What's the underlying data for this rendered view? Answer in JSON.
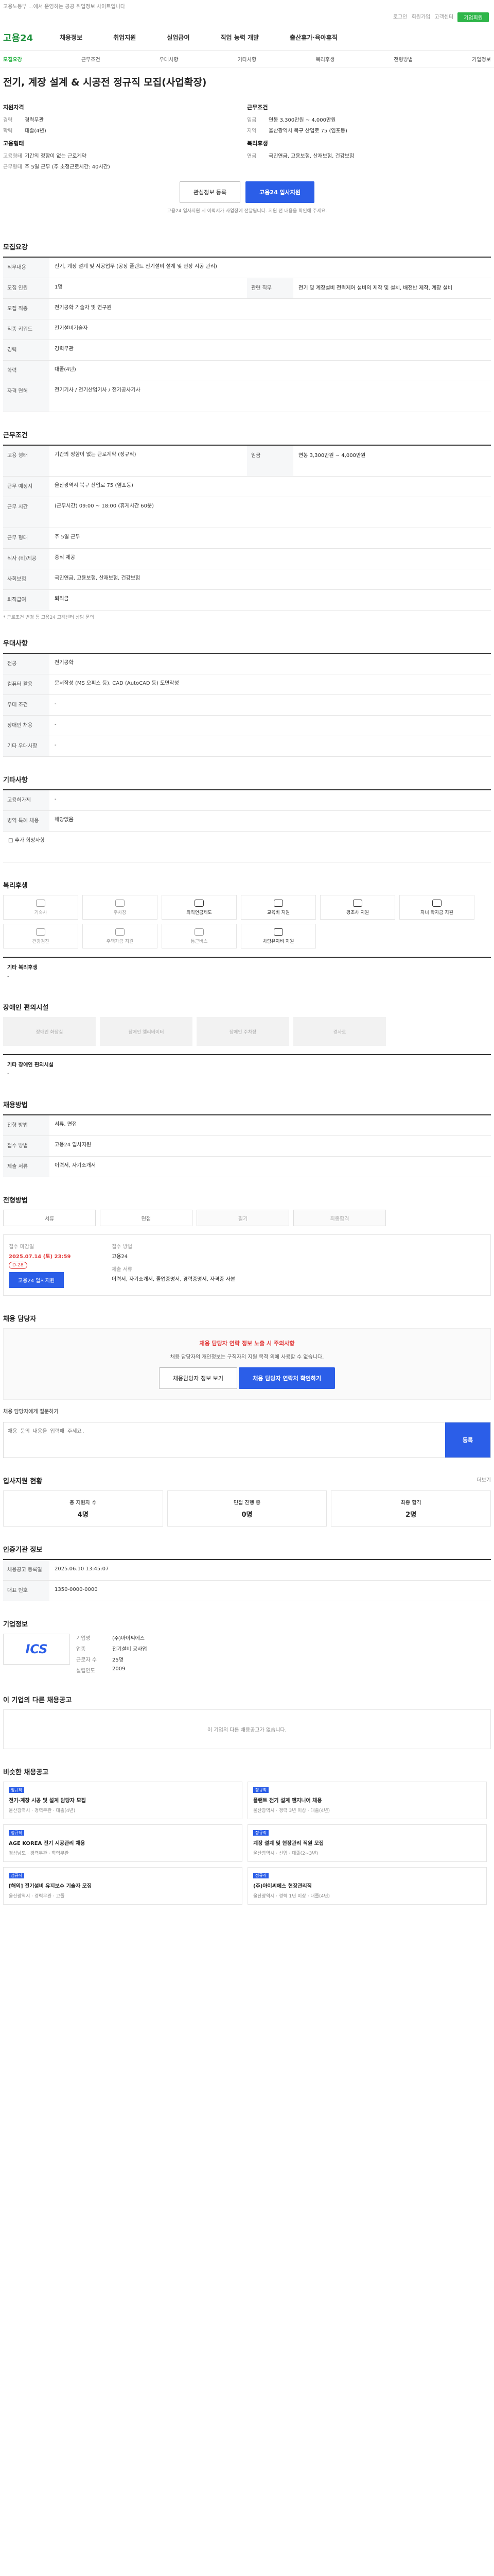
{
  "topbar": {
    "text": "고용노동부 ...에서 운영하는 공공 취업정보 사이트입니다"
  },
  "util": {
    "a": "로그인",
    "b": "회원가입",
    "c": "고객센터",
    "green": "기업회원"
  },
  "gnb": {
    "logo": "고용24",
    "items": [
      "채용정보",
      "취업지원",
      "실업급여",
      "직업 능력 개발",
      "출산휴가·육아휴직"
    ]
  },
  "tabs": [
    "모집요강",
    "근무조건",
    "우대사항",
    "기타사항",
    "복리후생",
    "전형방법",
    "기업정보"
  ],
  "title": "전기, 계장 설계 & 시공전 정규직 모집(사업확장)",
  "summary": {
    "req_title": "지원자격",
    "req_rows": [
      {
        "k": "경력",
        "v": "경력무관"
      },
      {
        "k": "학력",
        "v": "대졸(4년)"
      }
    ],
    "cond_title": "근무조건",
    "cond_rows": [
      {
        "k": "임금",
        "v": "연봉 3,300만원 ~ 4,000만원"
      },
      {
        "k": "지역",
        "v": "울산광역시 북구 산업로 75 (염포동)"
      }
    ],
    "type_title": "고용형태",
    "type_rows": [
      {
        "k": "고용형태",
        "v": "기간의 정함이 없는 근로계약"
      },
      {
        "k": "근무형태",
        "v": "주 5일 근무 (주 소정근로시간: 40시간)"
      }
    ],
    "welfare_title": "복리후생",
    "welfare_rows": [
      {
        "k": "연금",
        "v": "국민연금, 고용보험, 산재보험, 건강보험"
      }
    ]
  },
  "buttons": {
    "bookmark": "관심정보 등록",
    "apply": "고용24 입사지원"
  },
  "note": "고용24 입사지원 시 이력서가 사업장에 전달됩니다. 지원 전 내용을 확인해 주세요.",
  "sec1": {
    "title": "모집요강",
    "rows": [
      {
        "k": "직무내용",
        "v": "전기, 계장 설계 및 시공업무 (공장 플랜트 전기설비 설계 및 현장 시공 관리)"
      },
      {
        "k": "모집 인원",
        "v": "1명"
      },
      {
        "k": "모집 직종",
        "v": "전기공학 기술자 및 연구원"
      },
      {
        "k": "직종 키워드",
        "v": "전기설비기술자"
      },
      {
        "k": "경력",
        "v": "경력무관"
      },
      {
        "k": "학력",
        "v": "대졸(4년)"
      },
      {
        "k": "자격 면허",
        "v": "전기기사 / 전기산업기사 / 전기공사기사"
      }
    ],
    "side": {
      "k": "관련 직무",
      "v": "전기 및 계장설비 전력제어 설비의 제작 및 설치, 배전반 제작, 계장 설비"
    }
  },
  "sec2": {
    "title": "근무조건",
    "rows": [
      {
        "k": "고용 형태",
        "v": "기간의 정함이 없는 근로계약 (정규직)"
      },
      {
        "k": "근무 예정지",
        "v": "울산광역시 북구 산업로 75 (염포동)"
      },
      {
        "k": "근무 시간",
        "v": "(근무시간) 09:00 ~ 18:00 (휴게시간 60분)"
      },
      {
        "k": "근무 형태",
        "v": "주 5일 근무"
      },
      {
        "k": "식사 (비)제공",
        "v": "중식 제공"
      },
      {
        "k": "사회보험",
        "v": "국민연금, 고용보험, 산재보험, 건강보험"
      },
      {
        "k": "퇴직급여",
        "v": "퇴직금"
      }
    ],
    "wage": "연봉 3,300만원 ~ 4,000만원",
    "note": "* 근로조건 변경 등 고용24 고객센터 상담 문의"
  },
  "sec3": {
    "title": "우대사항",
    "rows": [
      {
        "k": "전공",
        "v": "전기공학"
      },
      {
        "k": "컴퓨터 활용",
        "v": "문서작성 (MS 오피스 등), CAD (AutoCAD 등) 도면작성"
      },
      {
        "k": "우대 조건",
        "v": "-"
      },
      {
        "k": "장애인 채용",
        "v": "-"
      },
      {
        "k": "기타 우대사항",
        "v": "-"
      }
    ]
  },
  "sec4": {
    "title": "기타사항",
    "rows": [
      {
        "k": "고용허가제",
        "v": "-"
      },
      {
        "k": "병역 특례 채용",
        "v": "해당없음"
      }
    ],
    "addinfo": "□ 추가 희망사항"
  },
  "sec5": {
    "title": "복리후생",
    "cards": [
      "기숙사",
      "주차장",
      "퇴직연금제도",
      "교육비 지원",
      "경조사 지원",
      "자녀 학자금 지원",
      "건강검진",
      "주택자금 지원",
      "통근버스",
      "차량유지비 지원"
    ],
    "cards_on": [
      2,
      3,
      4,
      5,
      9
    ],
    "extra_title": "기타 복리후생",
    "extra": "-"
  },
  "sec6": {
    "title": "장애인 편의시설",
    "cards": [
      "장애인 화장실",
      "장애인 엘리베이터",
      "장애인 주차장",
      "경사로"
    ],
    "extra_title": "기타 장애인 편의시설",
    "extra": "-"
  },
  "sec7": {
    "title": "채용방법",
    "rows": [
      {
        "k": "전형 방법",
        "v": "서류, 면접"
      },
      {
        "k": "접수 방법",
        "v": "고용24 입사지원"
      },
      {
        "k": "제출 서류",
        "v": "이력서, 자기소개서"
      }
    ]
  },
  "sec8": {
    "title": "전형방법",
    "steps": [
      "서류",
      "면접",
      "필기",
      "최종합격"
    ],
    "applybox": {
      "deadline_label": "접수 마감일",
      "deadline": "2025.07.14 (토) 23:59",
      "dday": "D-28",
      "apply": "고용24 입사지원",
      "method_label": "접수 방법",
      "method": "고용24",
      "docs_label": "제출 서류",
      "docs": "이력서, 자기소개서, 졸업증명서, 경력증명서, 자격증 사본"
    }
  },
  "sec9": {
    "title": "채용 담당자",
    "alert": "채용 담당자 연락 정보 노출 시 주의사항",
    "alert_body": "채용 담당자의 개인정보는 구직자의 지원 목적 외에 사용할 수 없습니다.",
    "btn1": "채용담당자 정보 보기",
    "btn2": "채용 담당자 연락처 확인하기",
    "comment_label": "채용 담당자에게 질문하기",
    "placeholder": "채용 문의 내용을 입력해 주세요.",
    "submit": "등록"
  },
  "sec10": {
    "title": "입사지원 현황",
    "more": "더보기",
    "stats": [
      {
        "k": "총 지원자 수",
        "v": "4명"
      },
      {
        "k": "면접 진행 중",
        "v": "0명"
      },
      {
        "k": "최종 합격",
        "v": "2명"
      }
    ]
  },
  "sec11": {
    "title": "인증기관 정보",
    "rows": [
      {
        "k": "채용공고 등록일",
        "v": "2025.06.10 13:45:07"
      },
      {
        "k": "대표 번호",
        "v": "1350-0000-0000"
      }
    ]
  },
  "sec12": {
    "title": "기업정보",
    "logo": "ICS",
    "rows": [
      {
        "k": "기업명",
        "v": "(주)아이씨에스"
      },
      {
        "k": "업종",
        "v": "전기설비 공사업"
      },
      {
        "k": "근로자 수",
        "v": "25명"
      },
      {
        "k": "설립연도",
        "v": "2009"
      }
    ]
  },
  "sec13": {
    "title": "이 기업의 다른 채용공고",
    "empty": "이 기업의 다른 채용공고가 없습니다."
  },
  "sec14": {
    "title": "비슷한 채용공고",
    "jobs": [
      {
        "tag": "정규직",
        "t": "전기·계장 시공 및 설계 담당자 모집",
        "meta": "울산광역시 · 경력무관 · 대졸(4년)"
      },
      {
        "tag": "정규직",
        "t": "플랜트 전기 설계 엔지니어 채용",
        "meta": "울산광역시 · 경력 3년 이상 · 대졸(4년)"
      },
      {
        "tag": "정규직",
        "t": "AGE KOREA 전기 시공관리 채용",
        "meta": "경상남도 · 경력무관 · 학력무관"
      },
      {
        "tag": "정규직",
        "t": "계장 설계 및 현장관리 직원 모집",
        "meta": "울산광역시 · 신입 · 대졸(2~3년)"
      },
      {
        "tag": "정규직",
        "t": "[해외] 전기설비 유지보수 기술자 모집",
        "meta": "울산광역시 · 경력무관 · 고졸"
      },
      {
        "tag": "정규직",
        "t": "(주)아이씨에스 현장관리직",
        "meta": "울산광역시 · 경력 1년 이상 · 대졸(4년)"
      }
    ]
  }
}
